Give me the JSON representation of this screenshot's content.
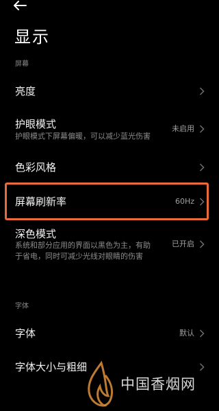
{
  "header": {
    "back_icon": "arrow-left-icon",
    "title": "显示"
  },
  "sections": {
    "screen_label": "屏幕",
    "font_label": "字体"
  },
  "rows": {
    "brightness": {
      "title": "亮度"
    },
    "eye_protection": {
      "title": "护眼模式",
      "subtitle": "护眼模式下屏幕偏暖，可以减少蓝光伤害",
      "value": "未启用"
    },
    "color_style": {
      "title": "色彩风格"
    },
    "refresh_rate": {
      "title": "屏幕刷新率",
      "value": "60Hz"
    },
    "dark_mode": {
      "title": "深色模式",
      "subtitle_line1": "系统和部分应用的界面以黑色为主，有助",
      "subtitle_line2": "于省电，同时可减少光线对眼睛的伤害",
      "value": "已开启"
    },
    "font": {
      "title": "字体",
      "value": "默认"
    },
    "font_size": {
      "title": "字体大小与粗细"
    }
  },
  "watermark": {
    "text": "中国香烟网",
    "icon": "flame-logo-icon"
  },
  "colors": {
    "background": "#000000",
    "highlight": "#ea6a3c",
    "watermark_flame": "#e0903a"
  }
}
